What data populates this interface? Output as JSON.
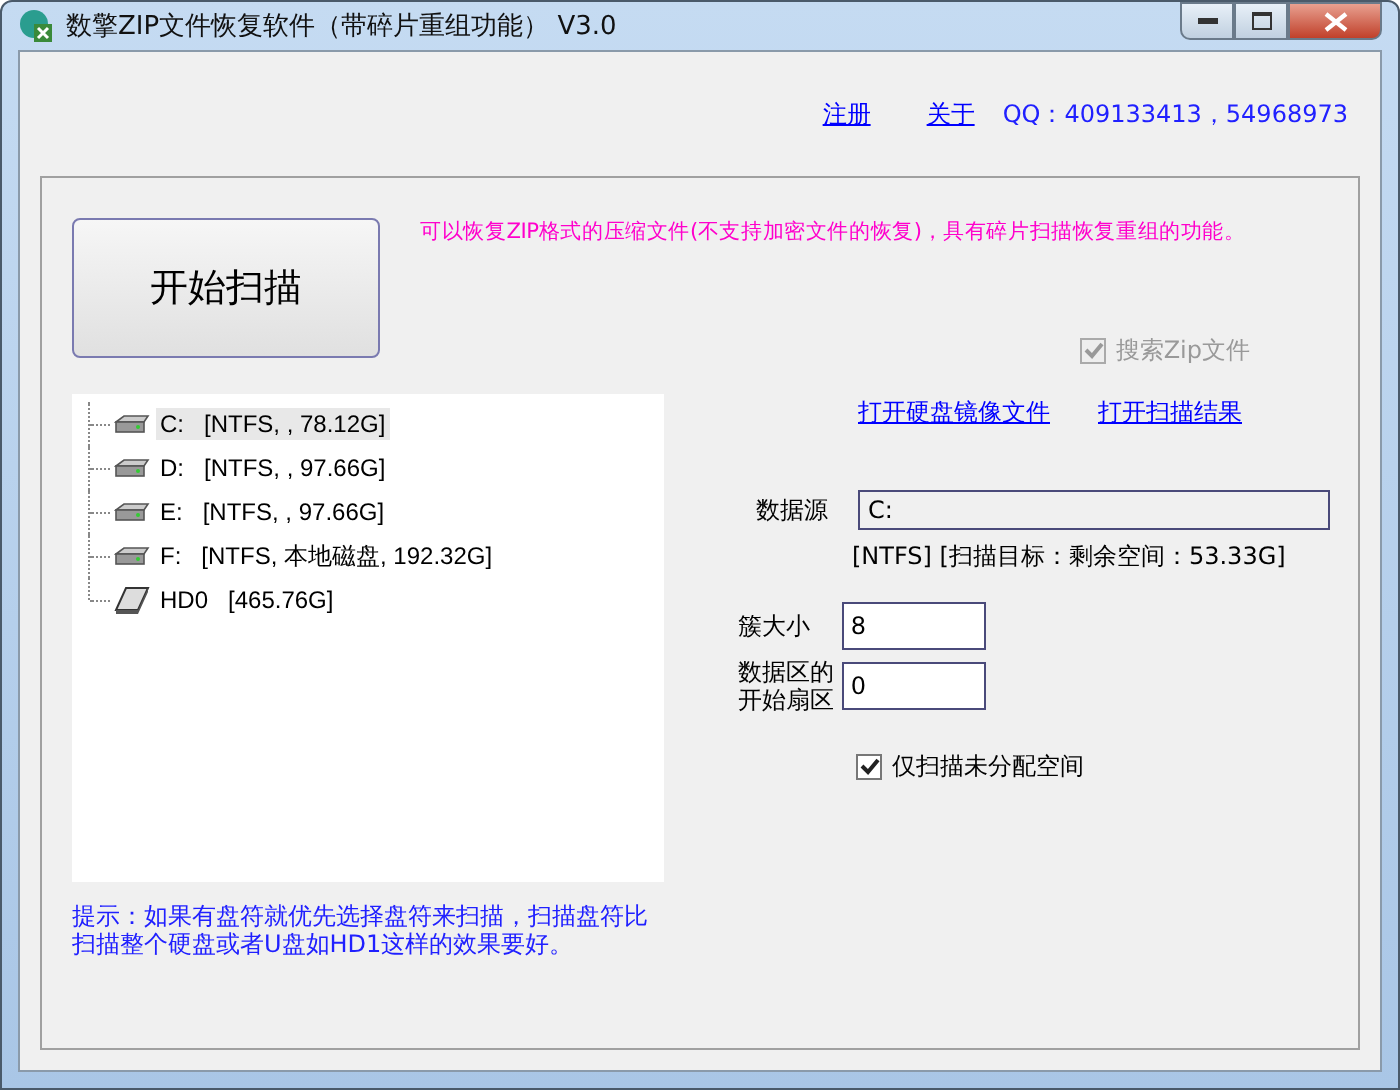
{
  "window": {
    "title": "数擎ZIP文件恢复软件（带碎片重组功能） V3.0"
  },
  "header_links": [
    {
      "text": "注册"
    },
    {
      "text": "关于"
    }
  ],
  "contact": "QQ：409133413，54968973",
  "scan_button": "开始扫描",
  "description": "可以恢复ZIP格式的压缩文件(不支持加密文件的恢复)，具有碎片扫描恢复重组的功能。",
  "search_zip": {
    "label": "搜索Zip文件",
    "checked": true,
    "disabled": true
  },
  "open_links": [
    {
      "text": "打开硬盘镜像文件"
    },
    {
      "text": "打开扫描结果"
    }
  ],
  "tree": [
    {
      "kind": "volume",
      "label": "C:",
      "detail": "[NTFS, , 78.12G]",
      "selected": true
    },
    {
      "kind": "volume",
      "label": "D:",
      "detail": "[NTFS, , 97.66G]",
      "selected": false
    },
    {
      "kind": "volume",
      "label": "E:",
      "detail": "[NTFS, , 97.66G]",
      "selected": false
    },
    {
      "kind": "volume",
      "label": "F:",
      "detail": "[NTFS, 本地磁盘, 192.32G]",
      "selected": false
    },
    {
      "kind": "disk",
      "label": "HD0",
      "detail": "[465.76G]",
      "selected": false
    }
  ],
  "data_source": {
    "label": "数据源",
    "value": "C:"
  },
  "fs_info": "[NTFS]  [扫描目标：剩余空间：53.33G]",
  "fields": [
    {
      "label": "簇大小",
      "value": "8"
    },
    {
      "label": "数据区的开始扇区",
      "value": "0"
    }
  ],
  "unallocated_only": {
    "label": "仅扫描未分配空间",
    "checked": true,
    "disabled": false
  },
  "hint": "提示：如果有盘符就优先选择盘符来扫描，扫描盘符比扫描整个硬盘或者U盘如HD1这样的效果要好。"
}
